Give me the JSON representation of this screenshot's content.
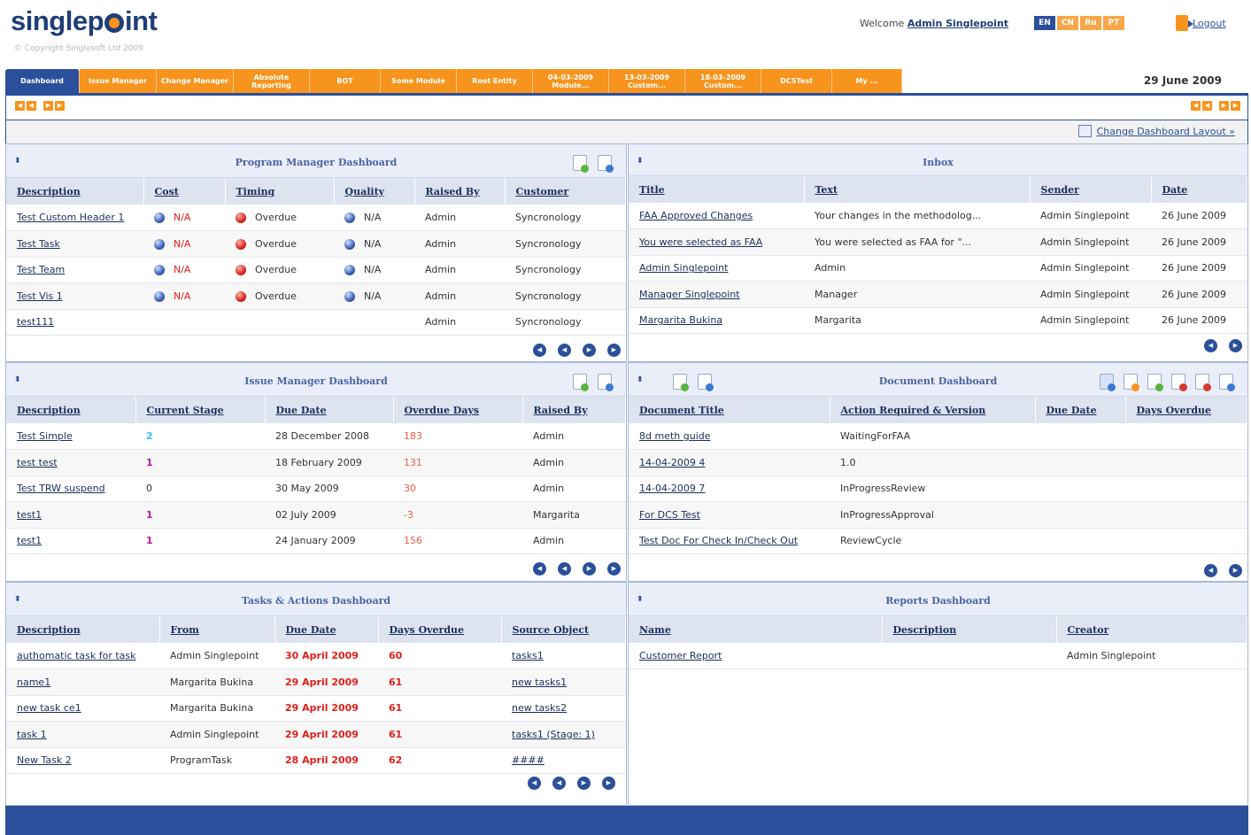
{
  "header": {
    "logo_text": "singlepoint",
    "copyright": "© Copyright Singlesoft Ltd 2009",
    "welcome_prefix": "Welcome",
    "welcome_user": "Admin Singlepoint",
    "languages": [
      "EN",
      "CN",
      "Ru",
      "PT"
    ],
    "active_language": "EN",
    "logout_label": "Logout"
  },
  "tabs": [
    {
      "label": "Dashboard",
      "active": true
    },
    {
      "label": "Issue Manager"
    },
    {
      "label": "Change Manager"
    },
    {
      "label": "Absolute Reporting"
    },
    {
      "label": "BOT"
    },
    {
      "label": "Some Module"
    },
    {
      "label": "Root Entity"
    },
    {
      "label": "04-03-2009 Module..."
    },
    {
      "label": "13-03-2009 Custom..."
    },
    {
      "label": "18-03-2009 Custom..."
    },
    {
      "label": "DCSTest"
    },
    {
      "label": "My ..."
    }
  ],
  "date": "29 June 2009",
  "change_layout_label": "Change Dashboard Layout »",
  "program_manager": {
    "title": "Program Manager Dashboard",
    "columns": [
      "Description",
      "Cost",
      "Timing",
      "Quality",
      "Raised By",
      "Customer"
    ],
    "rows": [
      {
        "description": "Test Custom Header 1",
        "cost": "N/A",
        "timing": "Overdue",
        "quality": "N/A",
        "raised_by": "Admin",
        "customer": "Syncronology"
      },
      {
        "description": "Test Task",
        "cost": "N/A",
        "timing": "Overdue",
        "quality": "N/A",
        "raised_by": "Admin",
        "customer": "Syncronology"
      },
      {
        "description": "Test Team",
        "cost": "N/A",
        "timing": "Overdue",
        "quality": "N/A",
        "raised_by": "Admin",
        "customer": "Syncronology"
      },
      {
        "description": "Test Vis 1",
        "cost": "N/A",
        "timing": "Overdue",
        "quality": "N/A",
        "raised_by": "Admin",
        "customer": "Syncronology"
      },
      {
        "description": "test111",
        "cost": "",
        "timing": "",
        "quality": "",
        "raised_by": "Admin",
        "customer": "Syncronology"
      }
    ]
  },
  "inbox": {
    "title": "Inbox",
    "columns": [
      "Title",
      "Text",
      "Sender",
      "Date"
    ],
    "rows": [
      {
        "title": "FAA Approved Changes",
        "text": "Your changes in the methodolog...",
        "sender": "Admin Singlepoint",
        "date": "26 June 2009"
      },
      {
        "title": "You were selected as FAA",
        "text": "You were selected as FAA for \"...",
        "sender": "Admin Singlepoint",
        "date": "26 June 2009"
      },
      {
        "title": "Admin Singlepoint",
        "text": "Admin",
        "sender": "Admin Singlepoint",
        "date": "26 June 2009"
      },
      {
        "title": "Manager Singlepoint",
        "text": "Manager",
        "sender": "Admin Singlepoint",
        "date": "26 June 2009"
      },
      {
        "title": "Margarita Bukina",
        "text": "Margarita",
        "sender": "Admin Singlepoint",
        "date": "26 June 2009"
      }
    ]
  },
  "issue_manager": {
    "title": "Issue Manager Dashboard",
    "columns": [
      "Description",
      "Current Stage",
      "Due Date",
      "Overdue Days",
      "Raised By"
    ],
    "rows": [
      {
        "description": "Test Simple",
        "stage": "2",
        "stage_color": "cyan",
        "due": "28 December 2008",
        "overdue": "183",
        "raised_by": "Admin"
      },
      {
        "description": "test test",
        "stage": "1",
        "stage_color": "mag",
        "due": "18 February 2009",
        "overdue": "131",
        "raised_by": "Admin"
      },
      {
        "description": "Test TRW suspend",
        "stage": "0",
        "stage_color": "",
        "due": "30 May 2009",
        "overdue": "30",
        "raised_by": "Admin"
      },
      {
        "description": "test1",
        "stage": "1",
        "stage_color": "mag",
        "due": "02 July 2009",
        "overdue": "-3",
        "raised_by": "Margarita"
      },
      {
        "description": "test1",
        "stage": "1",
        "stage_color": "mag",
        "due": "24 January 2009",
        "overdue": "156",
        "raised_by": "Admin"
      }
    ]
  },
  "document": {
    "title": "Document Dashboard",
    "columns": [
      "Document Title",
      "Action Required & Version",
      "Due Date",
      "Days Overdue"
    ],
    "rows": [
      {
        "title": "8d meth guide",
        "action": "WaitingForFAA",
        "due": "",
        "overdue": ""
      },
      {
        "title": "14-04-2009 4",
        "action": "1.0",
        "due": "",
        "overdue": ""
      },
      {
        "title": "14-04-2009 7",
        "action": "InProgressReview",
        "due": "",
        "overdue": ""
      },
      {
        "title": "For DCS Test",
        "action": "InProgressApproval",
        "due": "",
        "overdue": ""
      },
      {
        "title": "Test Doc For Check In/Check Out",
        "action": "ReviewCycle",
        "due": "",
        "overdue": ""
      }
    ]
  },
  "tasks": {
    "title": "Tasks & Actions Dashboard",
    "columns": [
      "Description",
      "From",
      "Due Date",
      "Days Overdue",
      "Source Object"
    ],
    "rows": [
      {
        "description": "authomatic task for task",
        "from": "Admin Singlepoint",
        "due": "30 April 2009",
        "overdue": "60",
        "source": "tasks1"
      },
      {
        "description": "name1",
        "from": "Margarita Bukina",
        "due": "29 April 2009",
        "overdue": "61",
        "source": "new tasks1"
      },
      {
        "description": "new task ce1",
        "from": "Margarita Bukina",
        "due": "29 April 2009",
        "overdue": "61",
        "source": "new tasks2"
      },
      {
        "description": "task 1",
        "from": "Admin Singlepoint",
        "due": "29 April 2009",
        "overdue": "61",
        "source": "tasks1 (Stage: 1)"
      },
      {
        "description": "New Task 2",
        "from": "ProgramTask",
        "due": "28 April 2009",
        "overdue": "62",
        "source": "####"
      }
    ]
  },
  "reports": {
    "title": "Reports Dashboard",
    "columns": [
      "Name",
      "Description",
      "Creator"
    ],
    "rows": [
      {
        "name": "Customer Report",
        "description": "",
        "creator": "Admin Singlepoint"
      }
    ]
  },
  "colors": {
    "brand_blue": "#2b4f9b",
    "brand_orange": "#f7941d",
    "overdue_red": "#e0201b"
  },
  "icons": {
    "pager": [
      "first-page-icon",
      "prev-page-icon",
      "next-page-icon",
      "last-page-icon"
    ]
  }
}
